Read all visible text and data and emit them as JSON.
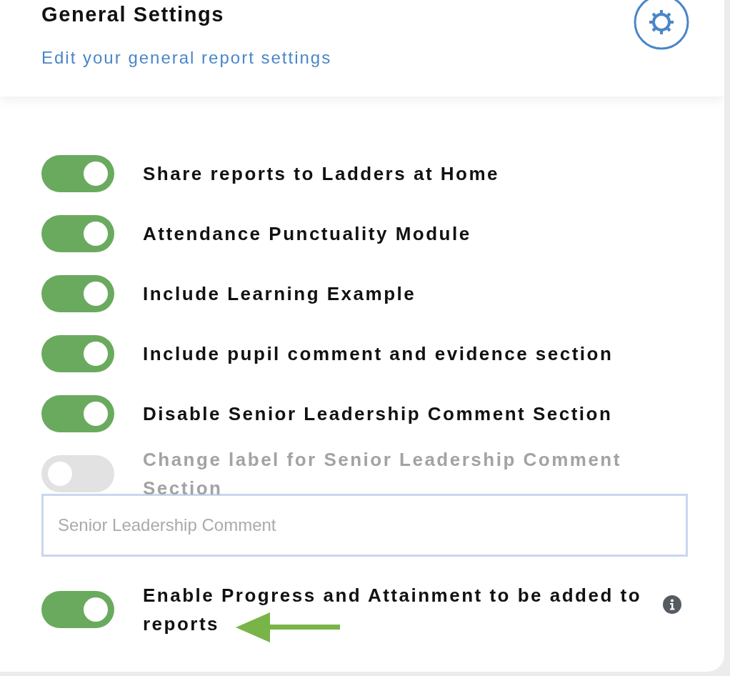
{
  "header": {
    "title": "General Settings",
    "subtitle": "Edit your general report settings"
  },
  "settings": [
    {
      "kind": "toggle",
      "label": "Share reports to Ladders at Home",
      "on": true,
      "disabled": false
    },
    {
      "kind": "toggle",
      "label": "Attendance Punctuality Module",
      "on": true,
      "disabled": false
    },
    {
      "kind": "toggle",
      "label": "Include Learning Example",
      "on": true,
      "disabled": false
    },
    {
      "kind": "toggle",
      "label": "Include pupil comment and evidence section",
      "on": true,
      "disabled": false
    },
    {
      "kind": "toggle",
      "label": "Disable Senior Leadership Comment Section",
      "on": true,
      "disabled": false
    },
    {
      "kind": "toggle",
      "label": "Change label for Senior Leadership Comment Section",
      "on": false,
      "disabled": true
    },
    {
      "kind": "field",
      "placeholder": "Senior Leadership Comment"
    },
    {
      "kind": "toggle",
      "label": "Enable Progress and Attainment to be added to reports",
      "on": true,
      "disabled": false,
      "info": true,
      "highlighted": true
    }
  ]
}
